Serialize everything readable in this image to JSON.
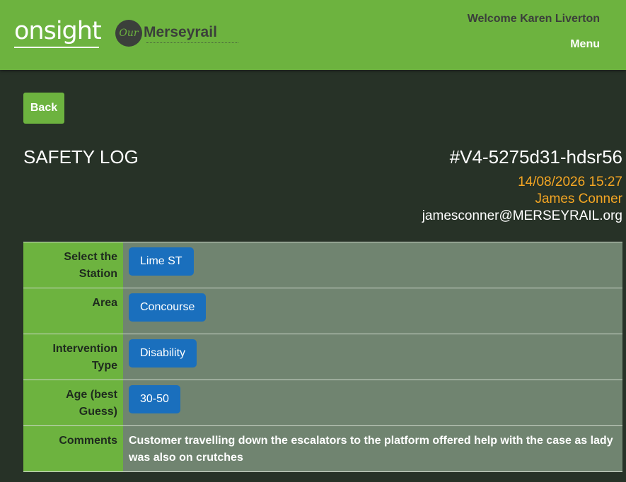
{
  "header": {
    "logo_text": "onsight",
    "brand_mark": "Our",
    "brand_name": "Merseyrail",
    "welcome": "Welcome Karen Liverton",
    "menu_label": "Menu",
    "accent_color": "#6db33f"
  },
  "actions": {
    "back_label": "Back"
  },
  "log": {
    "title": "SAFETY LOG",
    "id": "#V4-5275d31-hdsr56",
    "datetime": "14/08/2026 15:27",
    "author_name": "James Conner",
    "author_email": "jamesconner@MERSEYRAIL.org"
  },
  "fields": [
    {
      "label": "Select the Station",
      "value": "Lime ST"
    },
    {
      "label": "Area",
      "value": "Concourse"
    },
    {
      "label": "Intervention Type",
      "value": "Disability"
    },
    {
      "label": "Age (best Guess)",
      "value": "30-50"
    },
    {
      "label": "Comments",
      "value": "Customer travelling down the escalators to the platform offered help with the case as lady was also on crutches"
    }
  ]
}
